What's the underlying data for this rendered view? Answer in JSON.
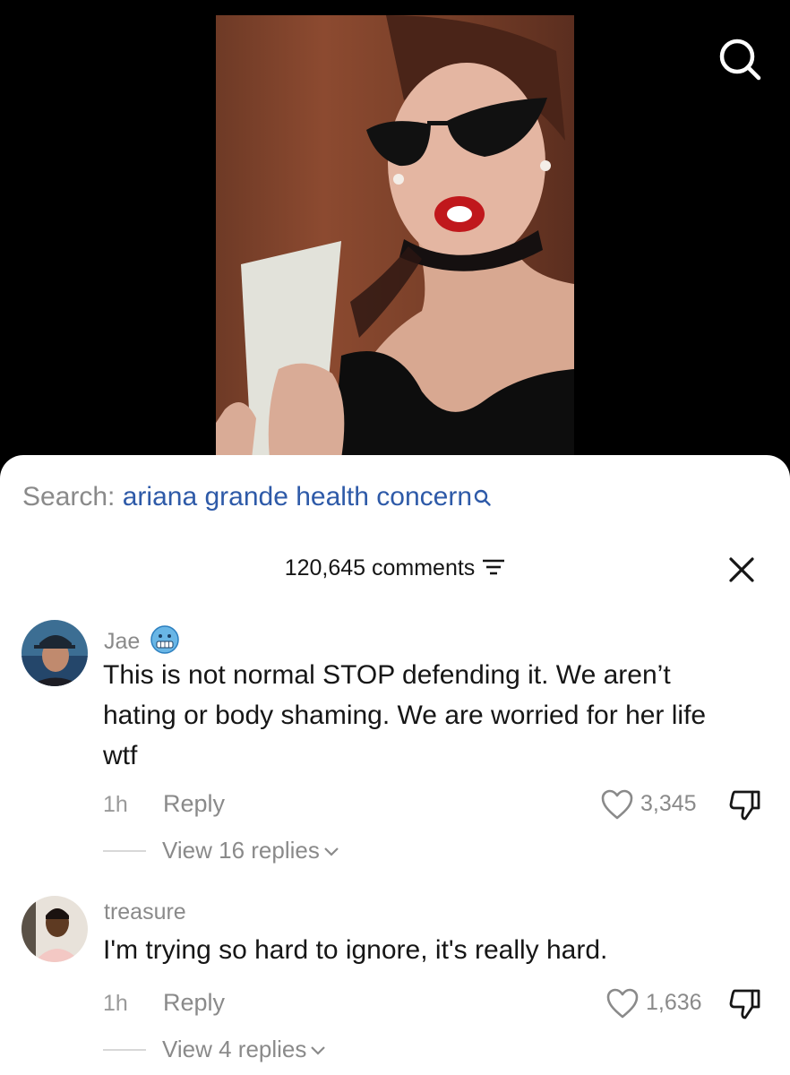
{
  "search": {
    "prefix": "Search: ",
    "query": "ariana grande health concern"
  },
  "comments_header": {
    "count_label": "120,645 comments"
  },
  "comments": [
    {
      "username": "Jae",
      "text_lines": [
        "This is not normal STOP defending it. We aren’t",
        "hating or body shaming. We are worried for her life",
        "wtf"
      ],
      "time": "1h",
      "reply_label": "Reply",
      "likes": "3,345",
      "view_replies": "View 16 replies"
    },
    {
      "username": "treasure",
      "text_lines": [
        "I'm trying so hard to ignore, it's really hard."
      ],
      "time": "1h",
      "reply_label": "Reply",
      "likes": "1,636",
      "view_replies": "View 4 replies"
    }
  ],
  "icons": {
    "top_search": "search-icon",
    "query_search": "search-icon",
    "filter": "filter-icon",
    "close": "close-icon",
    "like": "heart-icon",
    "dislike": "thumbs-down-icon",
    "chevron": "chevron-down-icon",
    "emoji": "cold-face-emoji"
  },
  "colors": {
    "query": "#2e5aa8",
    "text": "#161616",
    "muted": "#8a8a8a"
  }
}
